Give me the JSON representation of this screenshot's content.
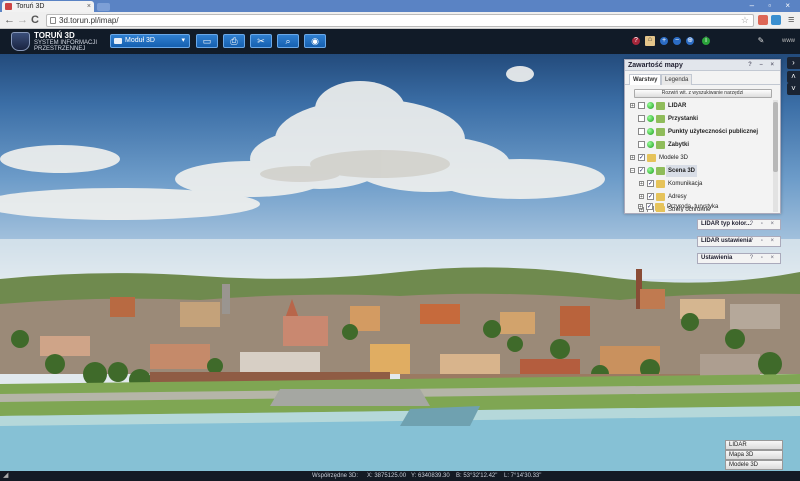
{
  "browser": {
    "tab_title": "Toruń 3D",
    "tab_close": "×",
    "url": "3d.torun.pl/imap/",
    "window_controls": "–  ▫  ×",
    "back": "←",
    "forward": "→",
    "reload": "C",
    "star": "☆",
    "menu": "≡"
  },
  "header": {
    "brand_title": "TORUŃ 3D",
    "brand_line2": "SYSTEM INFORMACJI",
    "brand_line3": "PRZESTRZENNEJ",
    "module_select": "Moduł 3D",
    "module_arrow": "▾",
    "tool_icons": [
      "list-icon",
      "print-icon",
      "tools-icon",
      "search-icon",
      "globe-icon"
    ],
    "tool_glyphs": [
      "▭",
      "⎙",
      "✂",
      "⌕",
      "◉"
    ],
    "right_glyphs": [
      "?",
      "⌂",
      "+",
      "−",
      "⊕",
      "i"
    ],
    "settings_glyph": "✎",
    "right_text": "www"
  },
  "side_arrows": {
    "right": "›",
    "up": "˄",
    "down": "˅"
  },
  "panel": {
    "title": "Zawartość mapy",
    "controls": "? – ×",
    "tabs": [
      {
        "label": "Warstwy",
        "active": true
      },
      {
        "label": "Legenda",
        "active": false
      }
    ],
    "toolbar_button": "Rozwiń wit. z wyszukiwanie narzędzi",
    "tree": [
      {
        "label": "LIDAR",
        "bold": true,
        "expander": "+",
        "checkbox": "",
        "indent": 0,
        "icon": "dot"
      },
      {
        "label": "Przystanki",
        "bold": true,
        "expander": "",
        "checkbox": "",
        "indent": 1,
        "icon": "dot"
      },
      {
        "label": "Punkty użyteczności publicznej",
        "bold": true,
        "expander": "",
        "checkbox": "",
        "indent": 1,
        "icon": "dot"
      },
      {
        "label": "Zabytki",
        "bold": true,
        "expander": "",
        "checkbox": "",
        "indent": 1,
        "icon": "dot"
      },
      {
        "label": "Modele 3D",
        "bold": false,
        "expander": "+",
        "checkbox": "✓",
        "indent": 0,
        "icon": "folder"
      },
      {
        "label": "Scena 3D",
        "bold": true,
        "expander": "−",
        "checkbox": "✓",
        "indent": 0,
        "icon": "dot",
        "selected": true
      },
      {
        "label": "Komunikacja",
        "bold": false,
        "expander": "+",
        "checkbox": "✓",
        "indent": 1,
        "icon": "folder"
      },
      {
        "label": "Adresy",
        "bold": false,
        "expander": "+",
        "checkbox": "✓",
        "indent": 1,
        "icon": "folder"
      },
      {
        "label": "Strefy ochronne",
        "bold": false,
        "expander": "+",
        "checkbox": "",
        "indent": 1,
        "icon": "folder"
      },
      {
        "label": "Przyroda, turystyka",
        "bold": false,
        "expander": "+",
        "checkbox": "✓",
        "indent": 1,
        "icon": "folder"
      }
    ]
  },
  "mini_panels": [
    {
      "title": "LIDAR typ kolor...",
      "controls": "? ▫ ×"
    },
    {
      "title": "LIDAR ustawienia",
      "controls": "? ▫ ×"
    },
    {
      "title": "Ustawienia",
      "controls": "? ▫ ×"
    }
  ],
  "view_buttons": [
    "LIDAR",
    "Mapa 3D",
    "Modele 3D"
  ],
  "status": {
    "corner": "◢",
    "coords_label": "Współrzędne 3D:",
    "x": "X: 3875125.00",
    "y": "Y: 6340839.30",
    "lat": "B: 53°32'12.42\"",
    "lon": "L: 7°14'30.33\""
  }
}
